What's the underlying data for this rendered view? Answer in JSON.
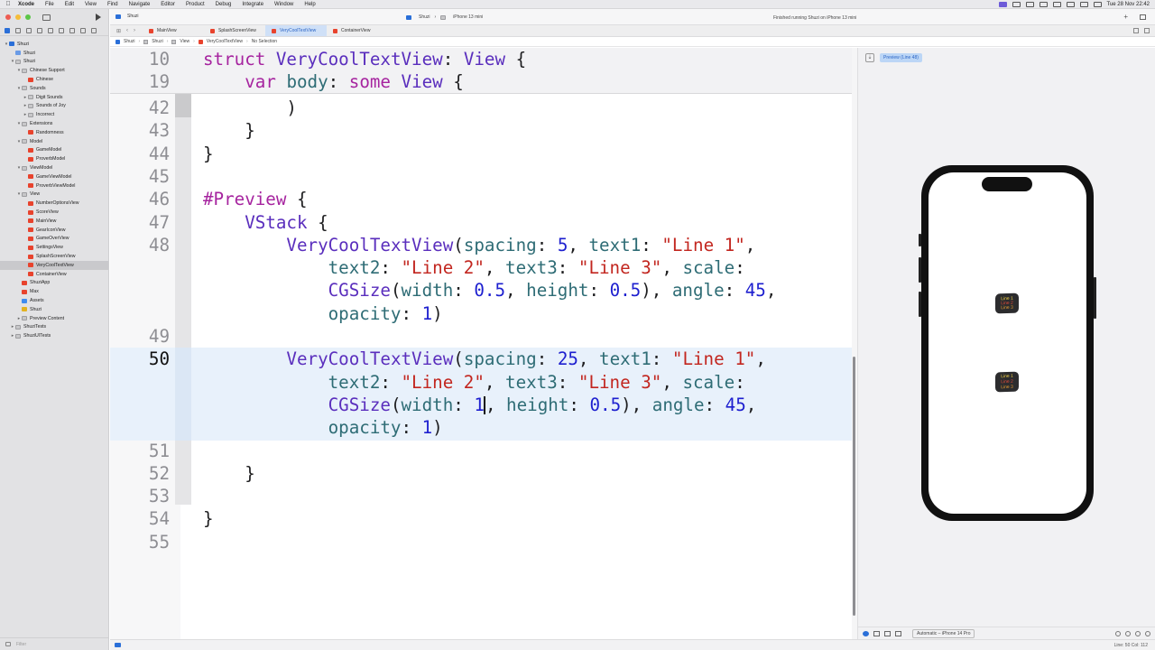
{
  "menubar": {
    "app": "Xcode",
    "items": [
      "File",
      "Edit",
      "View",
      "Find",
      "Navigate",
      "Editor",
      "Product",
      "Debug",
      "Integrate",
      "Window",
      "Help"
    ],
    "clock": "Tue 28 Nov  22:42"
  },
  "toolbar": {
    "project": "Shuzi",
    "scheme": "Shuzi",
    "destination": "iPhone 13 mini",
    "status": "Finished running Shuzi on iPhone 13 mini"
  },
  "tabs": [
    {
      "label": "MainView",
      "active": false
    },
    {
      "label": "SplashScreenView",
      "active": false
    },
    {
      "label": "VeryCoolTextView",
      "active": true
    },
    {
      "label": "ContainerView",
      "active": false
    }
  ],
  "jumpbar": [
    "Shuzi",
    "Shuzi",
    "View",
    "VeryCoolTextView",
    "No Selection"
  ],
  "navigator": {
    "filter_placeholder": "Filter",
    "tree": [
      {
        "label": "Shuzi",
        "depth": 0,
        "icon": "proj",
        "open": true
      },
      {
        "label": "Shuzi",
        "depth": 1,
        "icon": "group",
        "open": null
      },
      {
        "label": "Shuzi",
        "depth": 1,
        "icon": "folder",
        "open": true
      },
      {
        "label": "Chinese Support",
        "depth": 2,
        "icon": "folder",
        "open": true
      },
      {
        "label": "Chinese",
        "depth": 3,
        "icon": "swift",
        "open": null
      },
      {
        "label": "Sounds",
        "depth": 2,
        "icon": "folder",
        "open": true
      },
      {
        "label": "Digit Sounds",
        "depth": 3,
        "icon": "folder",
        "open": false
      },
      {
        "label": "Sounds of Joy",
        "depth": 3,
        "icon": "folder",
        "open": false
      },
      {
        "label": "Incorrect",
        "depth": 3,
        "icon": "folder",
        "open": false
      },
      {
        "label": "Extensions",
        "depth": 2,
        "icon": "folder",
        "open": true
      },
      {
        "label": "Randomness",
        "depth": 3,
        "icon": "swift",
        "open": null
      },
      {
        "label": "Model",
        "depth": 2,
        "icon": "folder",
        "open": true
      },
      {
        "label": "GameModel",
        "depth": 3,
        "icon": "swift",
        "open": null
      },
      {
        "label": "ProverbModel",
        "depth": 3,
        "icon": "swift",
        "open": null
      },
      {
        "label": "ViewModel",
        "depth": 2,
        "icon": "folder",
        "open": true
      },
      {
        "label": "GameViewModel",
        "depth": 3,
        "icon": "swift",
        "open": null
      },
      {
        "label": "ProverbViewModel",
        "depth": 3,
        "icon": "swift",
        "open": null
      },
      {
        "label": "View",
        "depth": 2,
        "icon": "folder",
        "open": true
      },
      {
        "label": "NumberOptionsView",
        "depth": 3,
        "icon": "swift",
        "open": null
      },
      {
        "label": "ScoreView",
        "depth": 3,
        "icon": "swift",
        "open": null
      },
      {
        "label": "MainView",
        "depth": 3,
        "icon": "swift",
        "open": null
      },
      {
        "label": "GearIconView",
        "depth": 3,
        "icon": "swift",
        "open": null
      },
      {
        "label": "GameOverView",
        "depth": 3,
        "icon": "swift",
        "open": null
      },
      {
        "label": "SettingsView",
        "depth": 3,
        "icon": "swift",
        "open": null
      },
      {
        "label": "SplashScreenView",
        "depth": 3,
        "icon": "swift",
        "open": null
      },
      {
        "label": "VeryCoolTextView",
        "depth": 3,
        "icon": "swift",
        "open": null,
        "selected": true
      },
      {
        "label": "ContainerView",
        "depth": 3,
        "icon": "swift",
        "open": null
      },
      {
        "label": "ShuziApp",
        "depth": 2,
        "icon": "swift",
        "open": null
      },
      {
        "label": "Max",
        "depth": 2,
        "icon": "swift",
        "open": null
      },
      {
        "label": "Assets",
        "depth": 2,
        "icon": "asset",
        "open": null
      },
      {
        "label": "Shuzi",
        "depth": 2,
        "icon": "yellow",
        "open": null
      },
      {
        "label": "Preview Content",
        "depth": 2,
        "icon": "folder",
        "open": false
      },
      {
        "label": "ShuziTests",
        "depth": 1,
        "icon": "folder",
        "open": false
      },
      {
        "label": "ShuziUITests",
        "depth": 1,
        "icon": "folder",
        "open": false
      }
    ]
  },
  "editor": {
    "sticky_lines": [
      {
        "num": "10",
        "tokens": [
          [
            "k",
            "struct "
          ],
          [
            "t",
            "VeryCoolTextView"
          ],
          [
            "x",
            ": "
          ],
          [
            "t",
            "View"
          ],
          [
            "x",
            " {"
          ]
        ]
      },
      {
        "num": "19",
        "tokens": [
          [
            "x",
            "    "
          ],
          [
            "k",
            "var "
          ],
          [
            "p",
            "body"
          ],
          [
            "x",
            ": "
          ],
          [
            "k",
            "some "
          ],
          [
            "t",
            "View"
          ],
          [
            "x",
            " {"
          ]
        ]
      }
    ],
    "lines": [
      {
        "num": "42",
        "tokens": [
          [
            "x",
            "        )"
          ]
        ]
      },
      {
        "num": "43",
        "tokens": [
          [
            "x",
            "    }"
          ]
        ]
      },
      {
        "num": "44",
        "tokens": [
          [
            "x",
            "}"
          ]
        ]
      },
      {
        "num": "45",
        "tokens": []
      },
      {
        "num": "46",
        "tokens": [
          [
            "k",
            "#Preview"
          ],
          [
            "x",
            " {"
          ]
        ]
      },
      {
        "num": "47",
        "tokens": [
          [
            "x",
            "    "
          ],
          [
            "t",
            "VStack"
          ],
          [
            "x",
            " {"
          ]
        ]
      },
      {
        "num": "48",
        "tokens": [
          [
            "x",
            "        "
          ],
          [
            "t",
            "VeryCoolTextView"
          ],
          [
            "x",
            "("
          ],
          [
            "p",
            "spacing"
          ],
          [
            "x",
            ": "
          ],
          [
            "n",
            "5"
          ],
          [
            "x",
            ", "
          ],
          [
            "p",
            "text1"
          ],
          [
            "x",
            ": "
          ],
          [
            "s",
            "\"Line 1\""
          ],
          [
            "x",
            ","
          ]
        ]
      },
      {
        "num": "",
        "tokens": [
          [
            "x",
            "            "
          ],
          [
            "p",
            "text2"
          ],
          [
            "x",
            ": "
          ],
          [
            "s",
            "\"Line 2\""
          ],
          [
            "x",
            ", "
          ],
          [
            "p",
            "text3"
          ],
          [
            "x",
            ": "
          ],
          [
            "s",
            "\"Line 3\""
          ],
          [
            "x",
            ", "
          ],
          [
            "p",
            "scale"
          ],
          [
            "x",
            ":"
          ]
        ]
      },
      {
        "num": "",
        "tokens": [
          [
            "x",
            "            "
          ],
          [
            "t",
            "CGSize"
          ],
          [
            "x",
            "("
          ],
          [
            "p",
            "width"
          ],
          [
            "x",
            ": "
          ],
          [
            "n",
            "0.5"
          ],
          [
            "x",
            ", "
          ],
          [
            "p",
            "height"
          ],
          [
            "x",
            ": "
          ],
          [
            "n",
            "0.5"
          ],
          [
            "x",
            "), "
          ],
          [
            "p",
            "angle"
          ],
          [
            "x",
            ": "
          ],
          [
            "n",
            "45"
          ],
          [
            "x",
            ","
          ]
        ]
      },
      {
        "num": "",
        "tokens": [
          [
            "x",
            "            "
          ],
          [
            "p",
            "opacity"
          ],
          [
            "x",
            ": "
          ],
          [
            "n",
            "1"
          ],
          [
            "x",
            ")"
          ]
        ]
      },
      {
        "num": "49",
        "tokens": []
      },
      {
        "num": "50",
        "current": true,
        "tokens": [
          [
            "x",
            "        "
          ],
          [
            "t",
            "VeryCoolTextView"
          ],
          [
            "x",
            "("
          ],
          [
            "p",
            "spacing"
          ],
          [
            "x",
            ": "
          ],
          [
            "n",
            "25"
          ],
          [
            "x",
            ", "
          ],
          [
            "p",
            "text1"
          ],
          [
            "x",
            ": "
          ],
          [
            "s",
            "\"Line 1\""
          ],
          [
            "x",
            ","
          ]
        ]
      },
      {
        "num": "",
        "tokens": [
          [
            "x",
            "            "
          ],
          [
            "p",
            "text2"
          ],
          [
            "x",
            ": "
          ],
          [
            "s",
            "\"Line 2\""
          ],
          [
            "x",
            ", "
          ],
          [
            "p",
            "text3"
          ],
          [
            "x",
            ": "
          ],
          [
            "s",
            "\"Line 3\""
          ],
          [
            "x",
            ", "
          ],
          [
            "p",
            "scale"
          ],
          [
            "x",
            ":"
          ]
        ]
      },
      {
        "num": "",
        "tokens": [
          [
            "x",
            "            "
          ],
          [
            "t",
            "CGSize"
          ],
          [
            "x",
            "("
          ],
          [
            "p",
            "width"
          ],
          [
            "x",
            ": "
          ],
          [
            "n",
            "1"
          ],
          [
            "c",
            ""
          ],
          [
            "x",
            ", "
          ],
          [
            "p",
            "height"
          ],
          [
            "x",
            ": "
          ],
          [
            "n",
            "0.5"
          ],
          [
            "x",
            "), "
          ],
          [
            "p",
            "angle"
          ],
          [
            "x",
            ": "
          ],
          [
            "n",
            "45"
          ],
          [
            "x",
            ","
          ]
        ]
      },
      {
        "num": "",
        "tokens": [
          [
            "x",
            "            "
          ],
          [
            "p",
            "opacity"
          ],
          [
            "x",
            ": "
          ],
          [
            "n",
            "1"
          ],
          [
            "x",
            ")"
          ]
        ]
      },
      {
        "num": "51",
        "tokens": []
      },
      {
        "num": "52",
        "tokens": [
          [
            "x",
            "    }"
          ]
        ]
      },
      {
        "num": "53",
        "tokens": []
      },
      {
        "num": "54",
        "tokens": [
          [
            "x",
            "}"
          ]
        ]
      },
      {
        "num": "55",
        "tokens": []
      }
    ]
  },
  "canvas": {
    "preview_button": "Preview (Line 48)",
    "device_menu": "Automatic – iPhone 14 Pro",
    "cards": [
      {
        "lines": [
          "Line 1",
          "Line 2",
          "Line 3"
        ]
      },
      {
        "lines": [
          "Line 1",
          "Line 2",
          "Line 3"
        ]
      }
    ]
  },
  "statusbar": {
    "position": "Line: 50  Col: 112"
  },
  "colors": {
    "keyword": "#a6249f",
    "type": "#5a2ebd",
    "string": "#c2261f",
    "number": "#1d1fcf",
    "param": "#2e6c75",
    "accent": "#2a6fd8"
  }
}
